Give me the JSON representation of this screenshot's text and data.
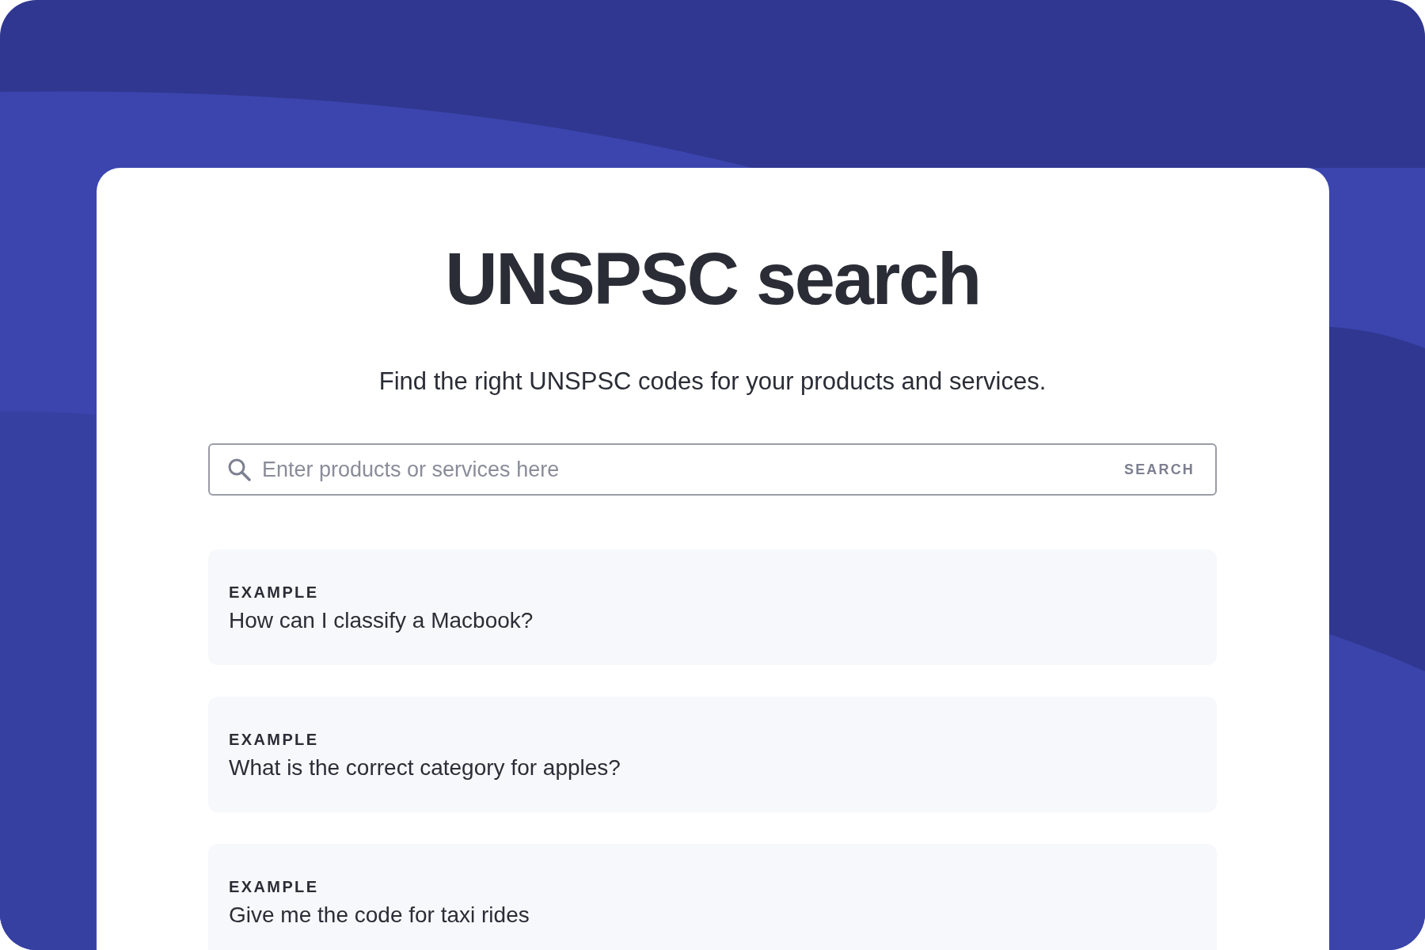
{
  "title": "UNSPSC search",
  "subtitle": "Find the right UNSPSC codes for your products and services.",
  "search": {
    "placeholder": "Enter products or services here",
    "button": "SEARCH"
  },
  "examples": [
    {
      "label": "EXAMPLE",
      "text": "How can I classify a Macbook?"
    },
    {
      "label": "EXAMPLE",
      "text": "What is the correct category for apples?"
    },
    {
      "label": "EXAMPLE",
      "text": "Give me the code for taxi rides"
    }
  ]
}
